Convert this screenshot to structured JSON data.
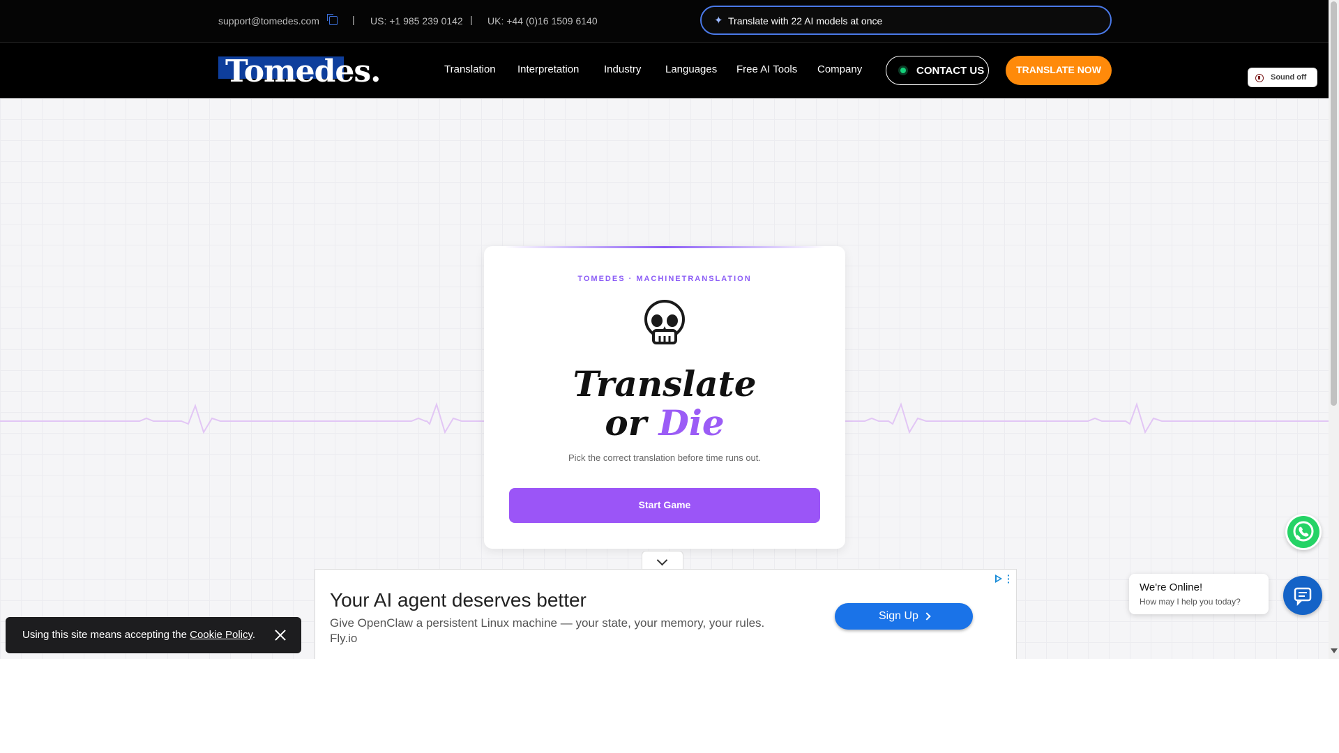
{
  "topbar": {
    "email": "support@tomedes.com",
    "separator": "|",
    "us_phone": "US: +1 985 239 0142",
    "uk_phone": "UK: +44 (0)16 1509 6140",
    "ai_pill_text": "Translate with 22 AI models at once"
  },
  "nav": {
    "logo": "Tomedes.",
    "items": [
      {
        "label": "Translation"
      },
      {
        "label": "Interpretation"
      },
      {
        "label": "Industry"
      },
      {
        "label": "Languages"
      },
      {
        "label": "Free AI Tools"
      },
      {
        "label": "Company"
      }
    ],
    "contact_label": "CONTACT US",
    "translate_label": "TRANSLATE NOW"
  },
  "sound": {
    "label": "Sound off"
  },
  "game": {
    "kicker": "TOMEDES · MACHINETRANSLATION",
    "title_line1": "Translate",
    "title_line2_prefix": "or ",
    "title_line2_accent": "Die",
    "subtitle": "Pick the correct translation before time runs out.",
    "start_label": "Start Game"
  },
  "ad": {
    "title": "Your AI agent deserves better",
    "body": "Give OpenClaw a persistent Linux machine — your state, your memory, your rules.",
    "advertiser": "Fly.io",
    "cta": "Sign Up"
  },
  "cookie": {
    "text_prefix": "Using this site means accepting the ",
    "link": "Cookie Policy",
    "text_suffix": "."
  },
  "chat": {
    "title": "We're Online!",
    "subtitle": "How may I help you today?"
  },
  "colors": {
    "accent_purple": "#9b55f7",
    "orange": "#ff8a0a",
    "chat_blue": "#1463c7",
    "whatsapp_green": "#25d366"
  }
}
